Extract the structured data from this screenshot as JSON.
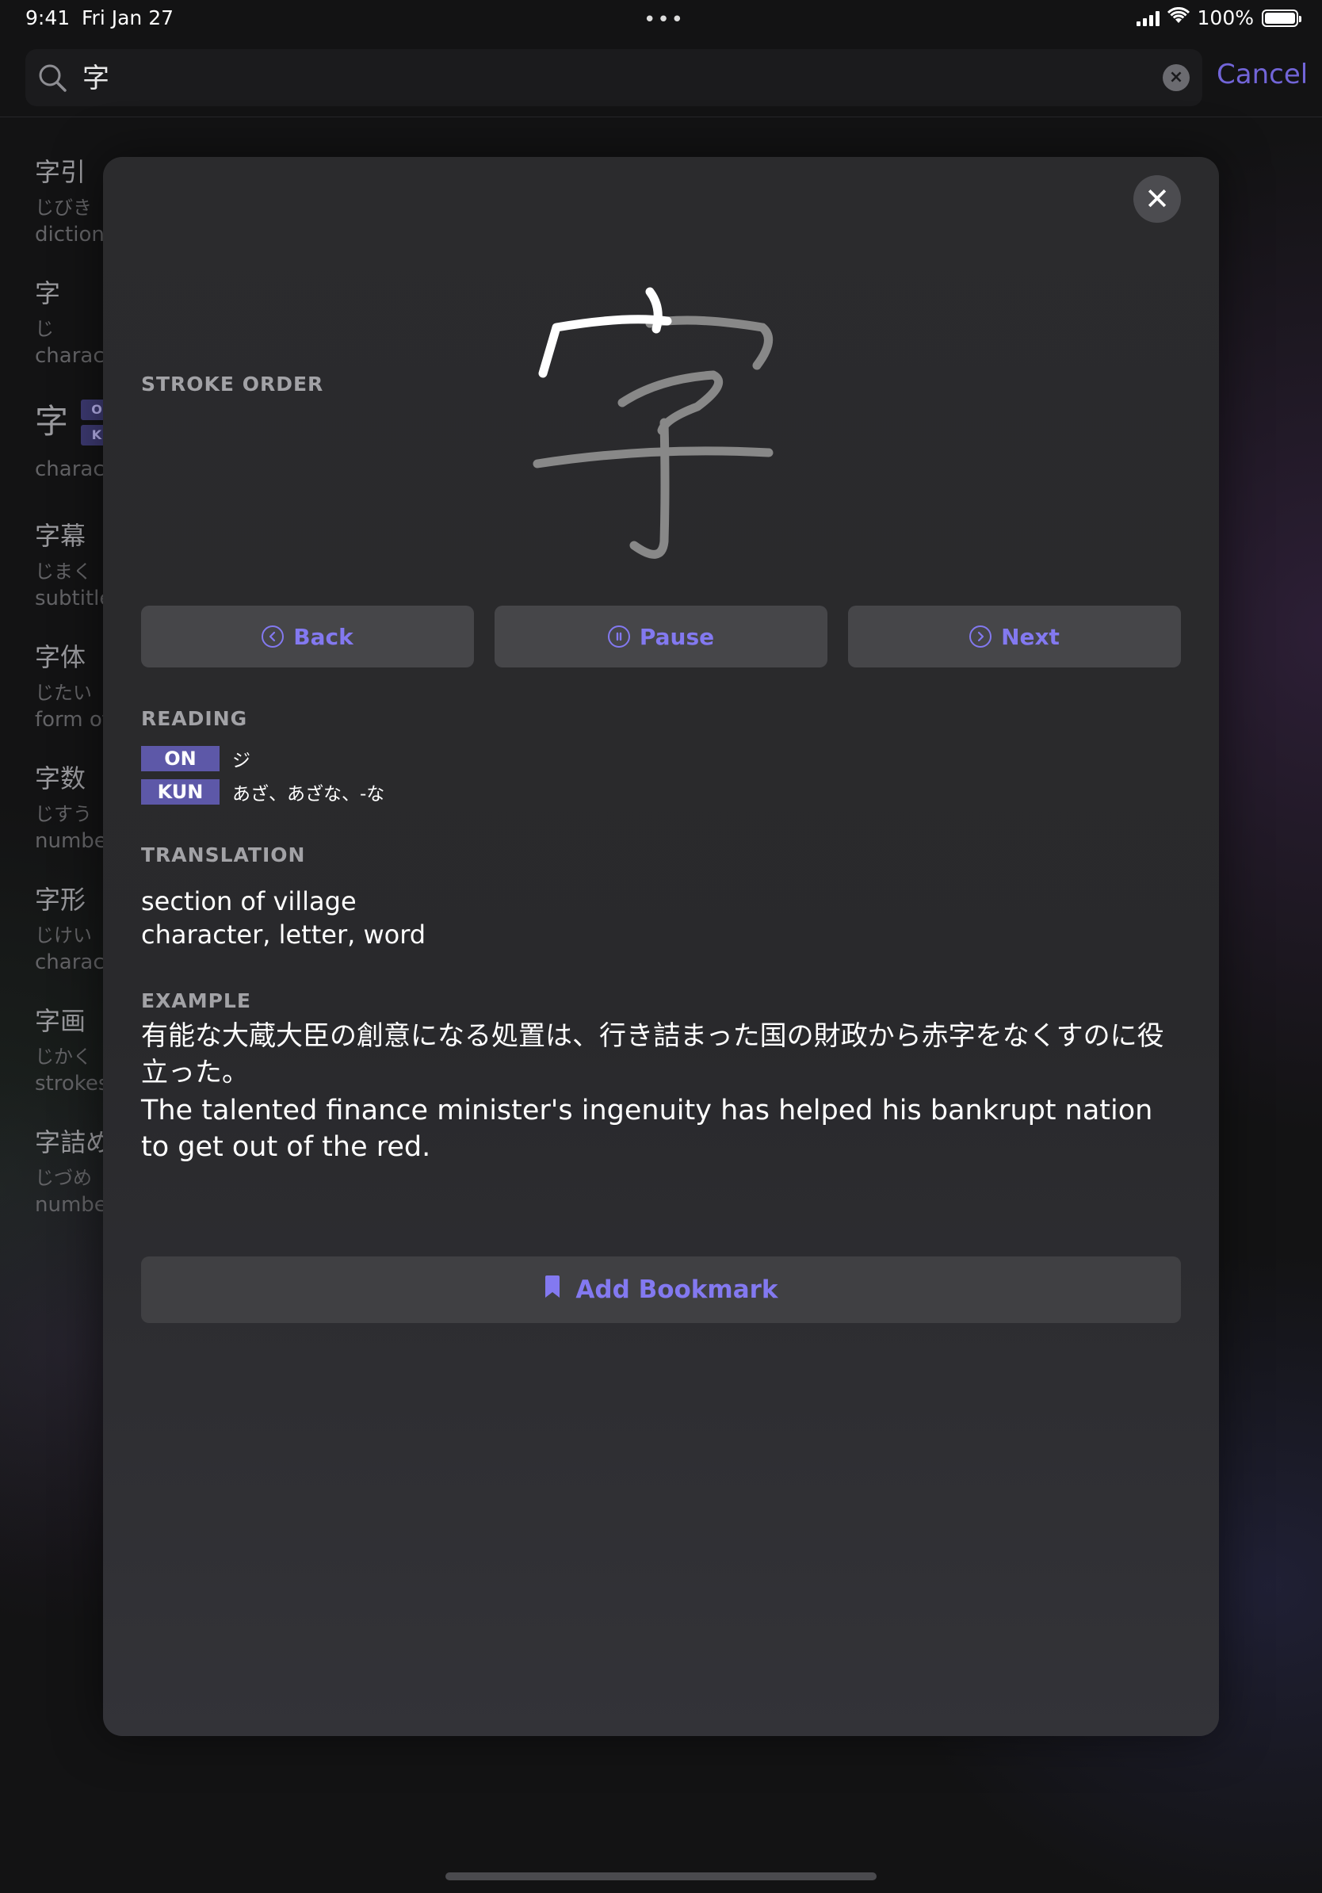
{
  "status_bar": {
    "time": "9:41",
    "date": "Fri Jan 27",
    "battery": "100%"
  },
  "search": {
    "query": "字",
    "cancel_label": "Cancel"
  },
  "results": [
    {
      "kanji": "字引",
      "kana": "じびき",
      "english": "dictionary"
    },
    {
      "kanji": "字",
      "kana": "じ",
      "english": "character"
    },
    {
      "kanji": "字",
      "kana": "",
      "english": "character",
      "tags": [
        "O",
        "K"
      ]
    },
    {
      "kanji": "字幕",
      "kana": "じまく",
      "english": "subtitle"
    },
    {
      "kanji": "字体",
      "kana": "じたい",
      "english": "form of"
    },
    {
      "kanji": "字数",
      "kana": "じすう",
      "english": "number"
    },
    {
      "kanji": "字形",
      "kana": "じけい",
      "english": "character"
    },
    {
      "kanji": "字画",
      "kana": "じかく",
      "english": "strokes"
    },
    {
      "kanji": "字詰め",
      "kana": "じづめ",
      "english": "number"
    }
  ],
  "modal": {
    "kanji": "字",
    "stroke_order": {
      "label": "STROKE ORDER",
      "back_label": "Back",
      "pause_label": "Pause",
      "next_label": "Next"
    },
    "reading": {
      "label": "READING",
      "on_tag": "ON",
      "on_value": "ジ",
      "kun_tag": "KUN",
      "kun_value": "あざ、あざな、-な"
    },
    "translation": {
      "label": "TRANSLATION",
      "lines": [
        "section of village",
        "character, letter, word"
      ]
    },
    "example": {
      "label": "EXAMPLE",
      "japanese": "有能な大蔵大臣の創意になる処置は、行き詰まった国の財政から赤字をなくすのに役立った。",
      "english": "The talented finance minister's ingenuity has helped his bankrupt nation to get out of the red."
    },
    "bookmark_label": "Add Bookmark"
  },
  "colors": {
    "accent": "#8379f0",
    "tag_bg": "#5d58a8",
    "modal_bg": "#2b2b2d"
  },
  "icons": [
    "search-icon",
    "clear-icon",
    "close-icon",
    "back-icon",
    "pause-icon",
    "next-icon",
    "bookmark-icon",
    "signal-icon",
    "wifi-icon",
    "battery-icon"
  ]
}
